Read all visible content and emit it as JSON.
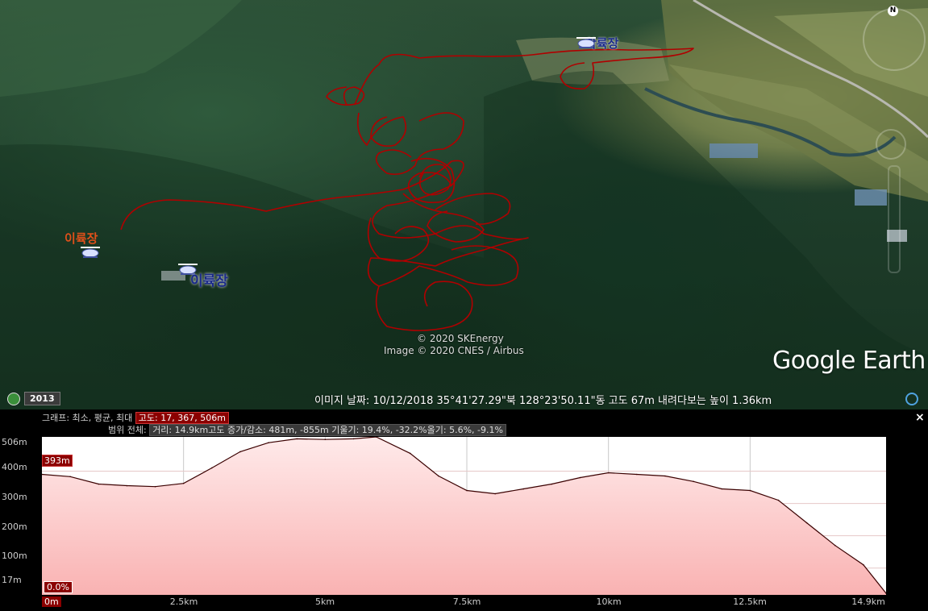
{
  "map": {
    "labels": {
      "landing_ne": "착륙장",
      "landing_w_top": "이륙장",
      "landing_w_mid": "이륙장"
    },
    "icons": [
      "helicopter-icon",
      "compass-icon",
      "look-control-icon",
      "zoom-slider-icon",
      "clock-icon"
    ],
    "watermark_line1": "© 2020 SKEnergy",
    "watermark_line2": "Image © 2020 CNES / Airbus",
    "logo": "Google Earth",
    "compass_letter": "N",
    "colors": {
      "track": "#b00000",
      "label_orange": "#e0501a",
      "label_blue": "#1a2a8a"
    }
  },
  "statusbar": {
    "year": "2013",
    "text": "이미지 날짜: 10/12/2018    35°41'27.29\"북  128°23'50.11\"동  고도     67m     내려다보는 높이   1.36km"
  },
  "profile": {
    "legend1_prefix": "그래프: 최소, 평균, 최대",
    "legend1_highlight": "고도: 17, 367, 506m",
    "legend2_prefix": "범위 전체:",
    "legend2_stats": "거리: 14.9km고도 증가/감소: 481m, -855m 기울기: 19.4%, -32.2%올기: 5.6%, -9.1%",
    "close_label": "×",
    "y_labels": [
      "506m",
      "400m",
      "300m",
      "200m",
      "100m",
      "17m"
    ],
    "x_labels": [
      "0m",
      "2.5km",
      "5km",
      "7.5km",
      "10km",
      "12.5km",
      "14.9km"
    ],
    "cursor_elevation": "393m",
    "cursor_grade": "0.0%"
  },
  "chart_data": {
    "type": "area",
    "xlabel": "",
    "ylabel": "",
    "x_unit": "km",
    "y_unit": "m",
    "xlim": [
      0,
      14.9
    ],
    "ylim": [
      17,
      506
    ],
    "x": [
      0,
      0.5,
      1.0,
      1.5,
      2.0,
      2.5,
      3.0,
      3.5,
      4.0,
      4.5,
      5.0,
      5.5,
      5.9,
      6.5,
      7.0,
      7.5,
      8.0,
      8.5,
      9.0,
      9.5,
      10.0,
      10.5,
      11.0,
      11.5,
      12.0,
      12.5,
      13.0,
      13.5,
      14.0,
      14.5,
      14.9
    ],
    "y": [
      390,
      383,
      360,
      355,
      352,
      362,
      410,
      460,
      488,
      500,
      498,
      500,
      506,
      455,
      385,
      340,
      330,
      345,
      360,
      380,
      395,
      390,
      385,
      368,
      345,
      340,
      310,
      240,
      170,
      110,
      22
    ]
  }
}
